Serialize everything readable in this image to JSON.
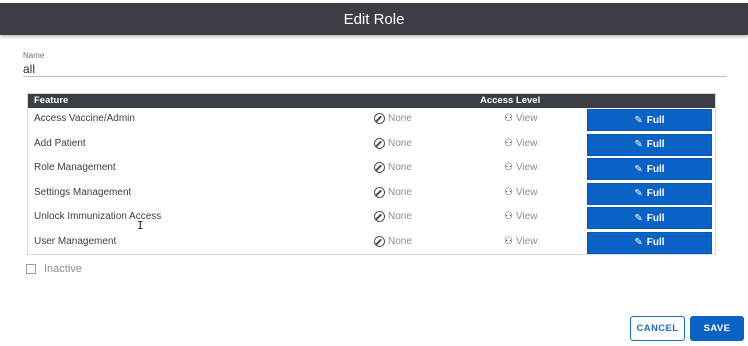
{
  "dialog": {
    "title": "Edit Role"
  },
  "name_field": {
    "label": "Name",
    "value": "all"
  },
  "table": {
    "columns": {
      "feature": "Feature",
      "access_level": "Access Level"
    },
    "option_labels": {
      "none": "None",
      "view": "View",
      "full": "Full"
    },
    "rows": [
      {
        "feature": "Access Vaccine/Admin",
        "selected": "Full"
      },
      {
        "feature": "Add Patient",
        "selected": "Full"
      },
      {
        "feature": "Role Management",
        "selected": "Full"
      },
      {
        "feature": "Settings Management",
        "selected": "Full"
      },
      {
        "feature": "Unlock Immunization Access",
        "selected": "Full"
      },
      {
        "feature": "User Management",
        "selected": "Full"
      }
    ]
  },
  "inactive": {
    "label": "Inactive",
    "checked": false
  },
  "footer": {
    "cancel_label": "CANCEL",
    "save_label": "SAVE"
  },
  "colors": {
    "header_bg": "#3b3f45",
    "primary": "#0b62c5"
  }
}
